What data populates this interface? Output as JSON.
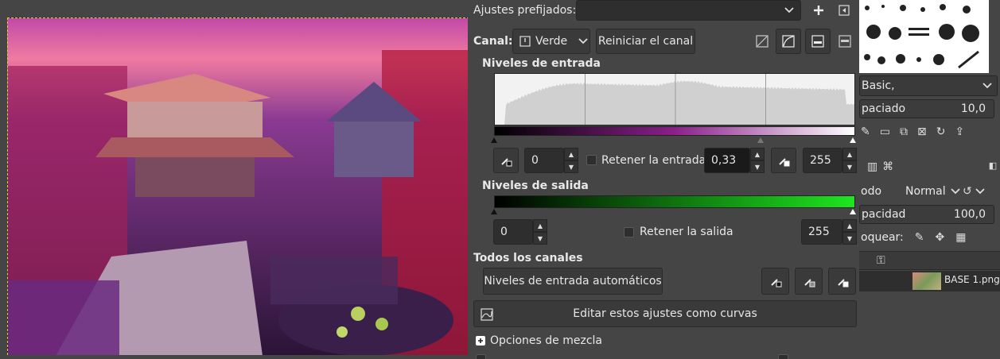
{
  "levels": {
    "presets_label": "Ajustes prefijados:",
    "presets_value": "",
    "channel_label": "Canal:",
    "channel_value": "Verde",
    "reset_channel": "Reiniciar el canal",
    "input_levels_title": "Niveles de entrada",
    "input_low": "0",
    "keep_input_label": "Retener la entrada",
    "gamma": "0,33",
    "input_high": "255",
    "output_levels_title": "Niveles de salida",
    "output_low": "0",
    "keep_output_label": "Retener la salida",
    "output_high": "255",
    "all_channels_title": "Todos los canales",
    "auto_input": "Niveles de entrada automáticos",
    "edit_curves": "Editar estos ajustes como curvas",
    "blend_options": "Opciones de mezcla"
  },
  "dock": {
    "brush_name": "Basic,",
    "spacing_label": "paciado",
    "spacing_value": "10,0",
    "mode_label": "odo",
    "mode_value": "Normal",
    "opacity_label": "pacidad",
    "opacity_value": "100,0",
    "lock_label": "oquear:",
    "layer_name": "BASE 1.png"
  },
  "colors": {
    "output_gradient_end": "#1ee61e",
    "input_gradient_end": "#c850c8"
  }
}
